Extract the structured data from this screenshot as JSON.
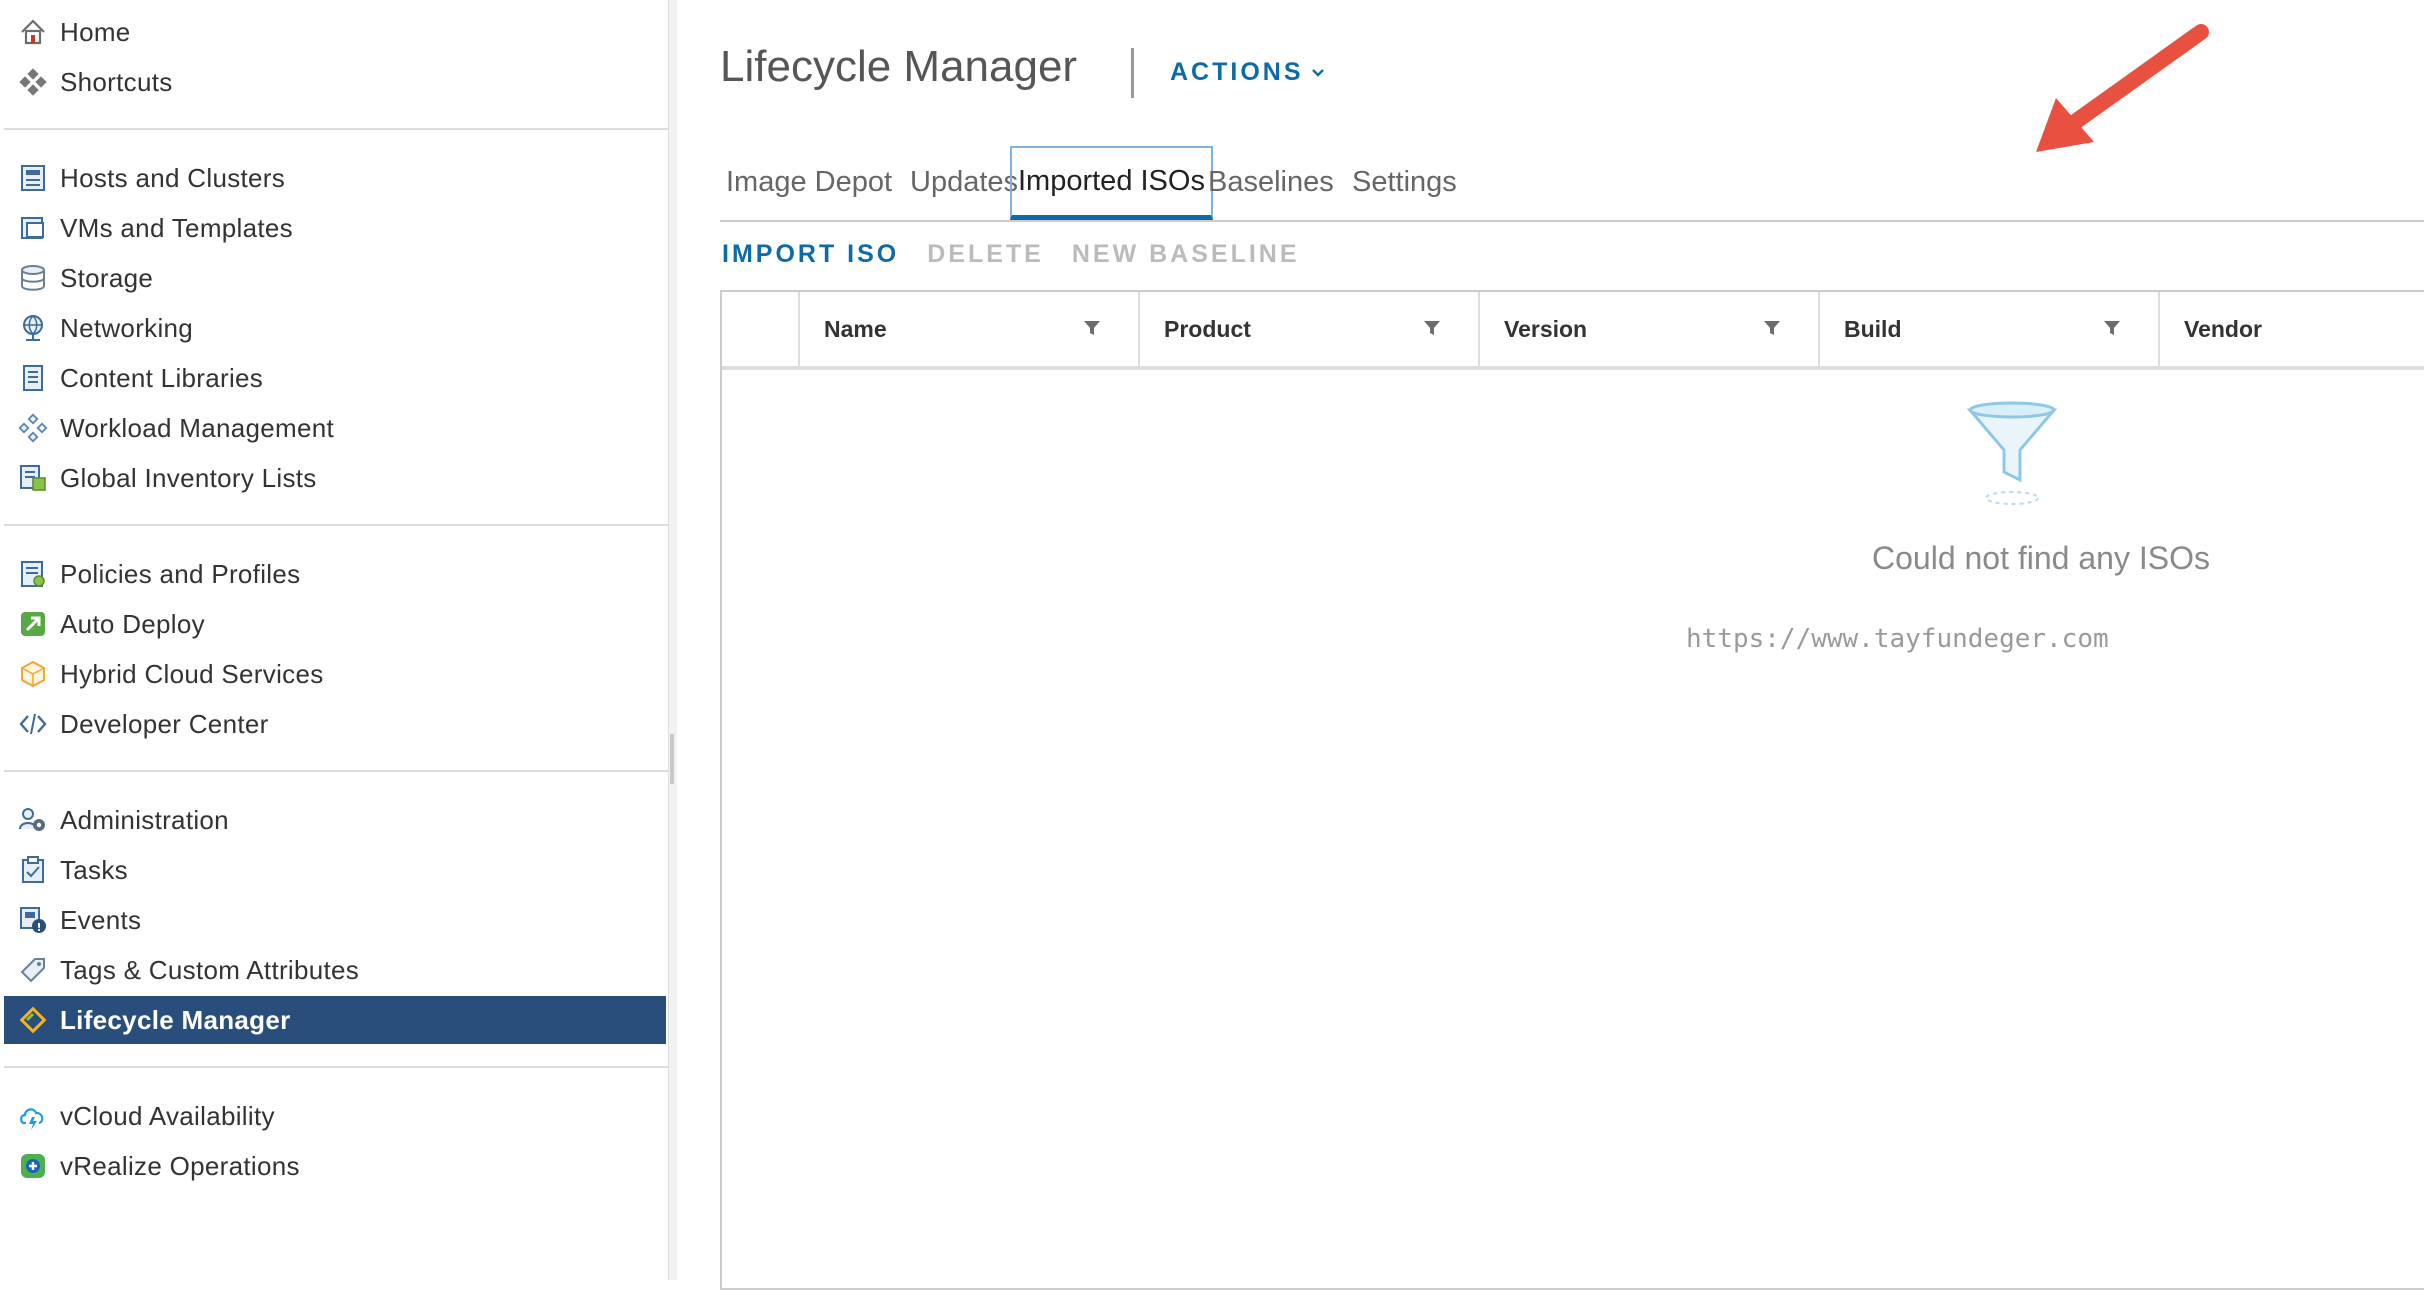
{
  "sidebar": {
    "group1": [
      {
        "label": "Home",
        "icon": "home-icon"
      },
      {
        "label": "Shortcuts",
        "icon": "shortcuts-icon"
      }
    ],
    "group2": [
      {
        "label": "Hosts and Clusters",
        "icon": "hosts-clusters-icon"
      },
      {
        "label": "VMs and Templates",
        "icon": "vms-templates-icon"
      },
      {
        "label": "Storage",
        "icon": "storage-icon"
      },
      {
        "label": "Networking",
        "icon": "networking-icon"
      },
      {
        "label": "Content Libraries",
        "icon": "content-libraries-icon"
      },
      {
        "label": "Workload Management",
        "icon": "workload-management-icon"
      },
      {
        "label": "Global Inventory Lists",
        "icon": "global-inventory-icon"
      }
    ],
    "group3": [
      {
        "label": "Policies and Profiles",
        "icon": "policies-icon"
      },
      {
        "label": "Auto Deploy",
        "icon": "auto-deploy-icon"
      },
      {
        "label": "Hybrid Cloud Services",
        "icon": "hybrid-cloud-icon"
      },
      {
        "label": "Developer Center",
        "icon": "developer-center-icon"
      }
    ],
    "group4": [
      {
        "label": "Administration",
        "icon": "administration-icon"
      },
      {
        "label": "Tasks",
        "icon": "tasks-icon"
      },
      {
        "label": "Events",
        "icon": "events-icon"
      },
      {
        "label": "Tags & Custom Attributes",
        "icon": "tags-icon"
      },
      {
        "label": "Lifecycle Manager",
        "icon": "lifecycle-manager-icon",
        "active": true
      }
    ],
    "group5": [
      {
        "label": "vCloud Availability",
        "icon": "vcloud-availability-icon"
      },
      {
        "label": "vRealize Operations",
        "icon": "vrealize-operations-icon"
      }
    ]
  },
  "header": {
    "title": "Lifecycle Manager",
    "actions_label": "ACTIONS"
  },
  "tabs": [
    {
      "label": "Image Depot"
    },
    {
      "label": "Updates"
    },
    {
      "label": "Imported ISOs",
      "active": true
    },
    {
      "label": "Baselines"
    },
    {
      "label": "Settings"
    }
  ],
  "toolbar": {
    "import_iso": "IMPORT ISO",
    "delete": "DELETE",
    "new_baseline": "NEW BASELINE"
  },
  "grid": {
    "columns": [
      "Name",
      "Product",
      "Version",
      "Build",
      "Vendor"
    ],
    "empty_message": "Could not find any ISOs"
  },
  "watermark": "https://www.tayfundeger.com",
  "colors": {
    "accent": "#0f6aa8",
    "active_nav_bg": "#2a4e7c",
    "annotation_arrow": "#e8513f"
  }
}
